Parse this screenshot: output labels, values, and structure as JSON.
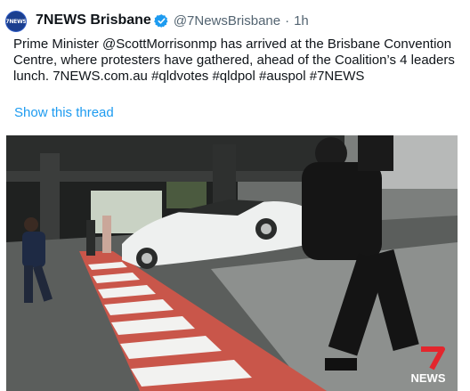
{
  "tweet": {
    "display_name": "7NEWS Brisbane",
    "handle": "@7NewsBrisbane",
    "separator": "·",
    "time": "1h",
    "body_segments": [
      {
        "text": "Prime Minister ",
        "link": false
      },
      {
        "text": "@ScottMorrisonmp",
        "link": true
      },
      {
        "text": " has arrived at the Brisbane Convention Centre, where protesters have gathered, ahead of the Coalition’s 4 leaders lunch. ",
        "link": false
      },
      {
        "text": "7NEWS.com.au",
        "link": true
      },
      {
        "text": " ",
        "link": false
      },
      {
        "text": "#qldvotes",
        "link": true
      },
      {
        "text": " ",
        "link": false
      },
      {
        "text": "#qldpol",
        "link": true
      },
      {
        "text": " ",
        "link": false
      },
      {
        "text": "#auspol",
        "link": true
      },
      {
        "text": " ",
        "link": false
      },
      {
        "text": "#7NEWS",
        "link": true
      }
    ],
    "show_thread_label": "Show this thread",
    "avatar_text": "7NEWS",
    "watermark_text": "NEWS"
  },
  "colors": {
    "link_blue": "#1d9bf0",
    "verified_blue": "#1d9bf0",
    "secondary_text": "#536471",
    "watermark_red": "#e3262d"
  },
  "icons": {
    "verified": "verified-badge-icon",
    "watermark": "7news-logo"
  }
}
